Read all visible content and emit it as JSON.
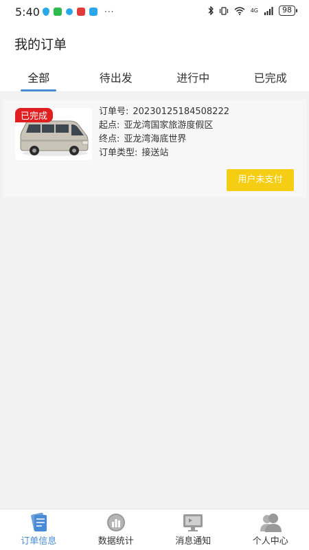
{
  "status_bar": {
    "time": "5:40",
    "more": "···",
    "battery": "98",
    "network": "4G"
  },
  "header": {
    "title": "我的订单"
  },
  "tabs": [
    {
      "label": "全部",
      "active": true
    },
    {
      "label": "待出发",
      "active": false
    },
    {
      "label": "进行中",
      "active": false
    },
    {
      "label": "已完成",
      "active": false
    }
  ],
  "orders": [
    {
      "status": "已完成",
      "order_no_label": "订单号:",
      "order_no": "20230125184508222",
      "start_label": "起点:",
      "start": "亚龙湾国家旅游度假区",
      "end_label": "终点:",
      "end": "亚龙湾海底世界",
      "type_label": "订单类型:",
      "type": "接送站",
      "action": "用户未支付"
    }
  ],
  "bottom_nav": [
    {
      "label": "订单信息",
      "icon": "order-info-icon",
      "active": true
    },
    {
      "label": "数据统计",
      "icon": "data-stats-icon",
      "active": false
    },
    {
      "label": "消息通知",
      "icon": "message-icon",
      "active": false
    },
    {
      "label": "个人中心",
      "icon": "profile-icon",
      "active": false
    }
  ],
  "colors": {
    "accent": "#4a8bd6",
    "badge": "#e02020",
    "pay_button": "#f5cd12"
  }
}
